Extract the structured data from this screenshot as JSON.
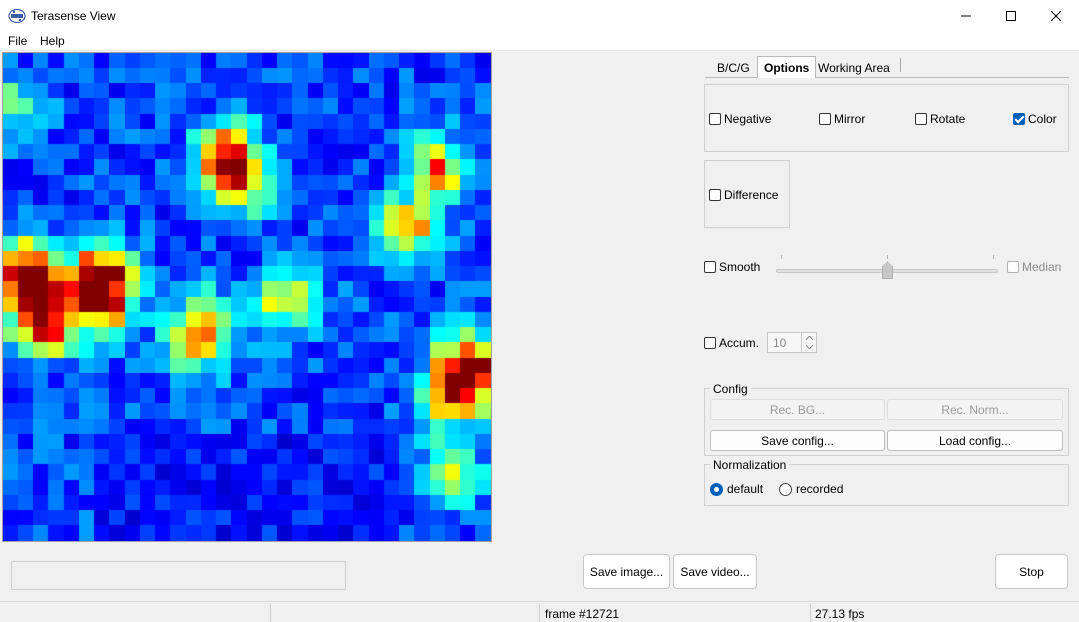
{
  "window": {
    "title": "Terasense View",
    "icon": "terasense-logo-icon"
  },
  "menu": [
    "File",
    "Help"
  ],
  "tabs": [
    {
      "label": "B/C/G",
      "active": false
    },
    {
      "label": "Options",
      "active": true
    },
    {
      "label": "Working Area",
      "active": false
    }
  ],
  "options": {
    "negative": {
      "label": "Negative",
      "checked": false
    },
    "mirror": {
      "label": "Mirror",
      "checked": false
    },
    "rotate": {
      "label": "Rotate",
      "checked": false
    },
    "color": {
      "label": "Color",
      "checked": true
    },
    "difference": {
      "label": "Difference",
      "checked": false
    },
    "smooth": {
      "label": "Smooth",
      "checked": false
    },
    "median": {
      "label": "Median",
      "checked": false,
      "enabled": false
    },
    "accum": {
      "label": "Accum.",
      "checked": false
    },
    "accum_value": "10"
  },
  "config": {
    "title": "Config",
    "rec_bg": "Rec. BG...",
    "rec_norm": "Rec. Norm...",
    "save_config": "Save config...",
    "load_config": "Load config..."
  },
  "normalization": {
    "title": "Normalization",
    "default_label": "default",
    "recorded_label": "recorded",
    "selected": "default"
  },
  "buttons": {
    "save_image": "Save image...",
    "save_video": "Save video...",
    "stop": "Stop"
  },
  "status": {
    "frame": "frame #12721",
    "fps": "27.13 fps"
  },
  "colors": {
    "accent": "#005fb8",
    "heatmap_low": "#000040",
    "heatmap_high": "#ff0000"
  },
  "heatmap": {
    "cols": 32,
    "rows": 32,
    "colormap": "jet"
  }
}
